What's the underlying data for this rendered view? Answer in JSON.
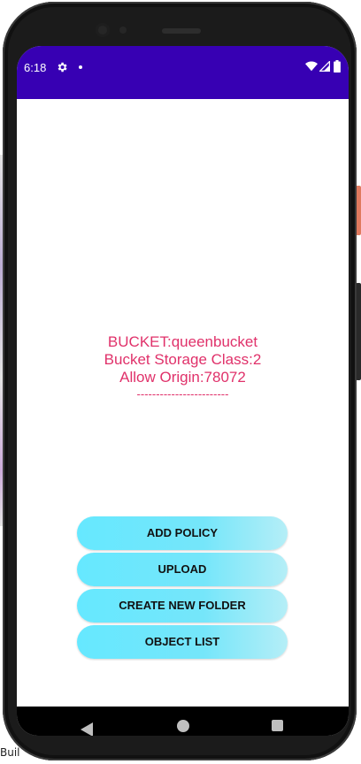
{
  "status_bar": {
    "time": "6:18",
    "icons": [
      "gear-icon",
      "notification-dot-icon",
      "wifi-icon",
      "signal-icon",
      "battery-icon"
    ],
    "color": "#3700b3"
  },
  "bucket_info": {
    "bucket": "BUCKET:queenbucket",
    "storage_class": "Bucket Storage Class:2",
    "allow_origin": "Allow Origin:78072",
    "divider": "------------------------",
    "text_color": "#e0316a"
  },
  "actions": {
    "add_policy": "ADD POLICY",
    "upload": "UPLOAD",
    "create_folder": "CREATE NEW FOLDER",
    "object_list": "OBJECT LIST",
    "button_color": "#66e8ff"
  },
  "nav_bar": {
    "icons": [
      "back-icon",
      "home-icon",
      "recents-icon"
    ]
  },
  "ide_hint": "Buil"
}
